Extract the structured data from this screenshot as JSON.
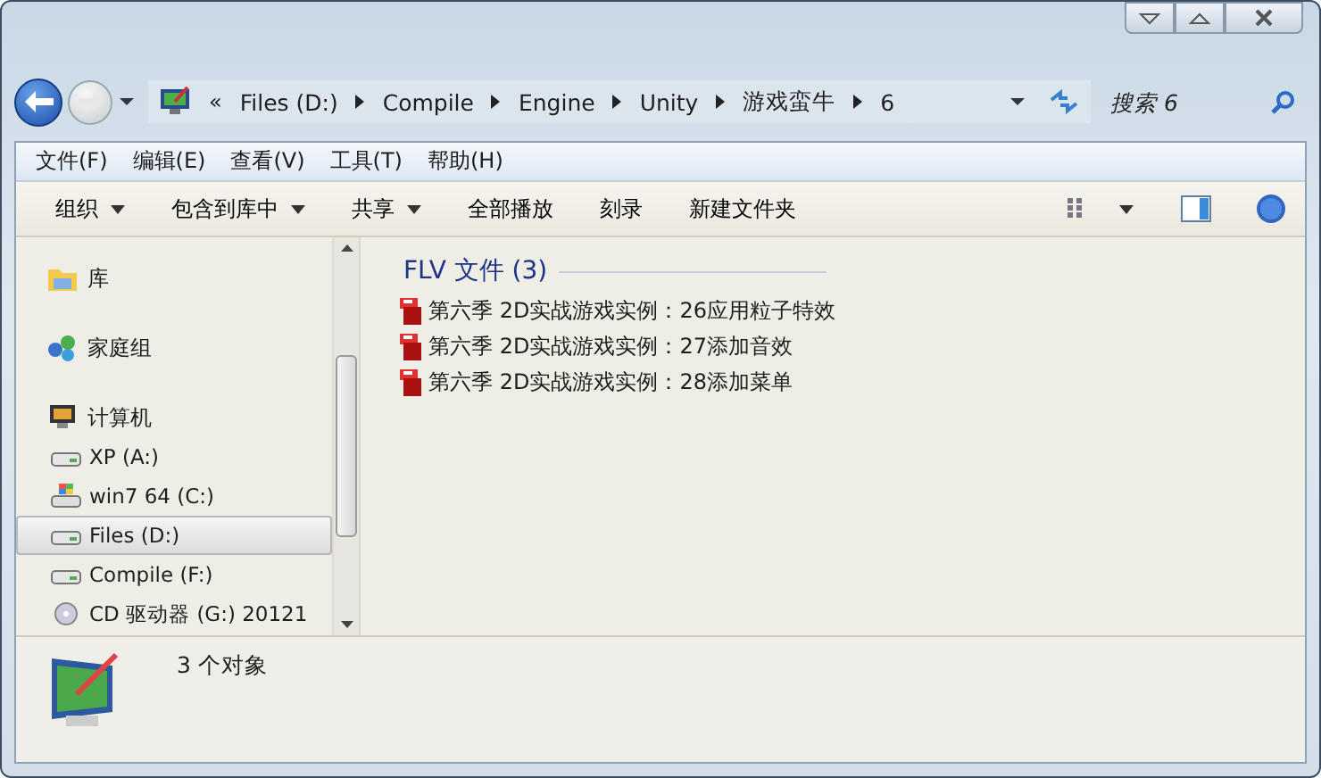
{
  "address_bar": {
    "overflow": "«",
    "crumbs": [
      "Files (D:)",
      "Compile",
      "Engine",
      "Unity",
      "游戏蛮牛",
      "6"
    ],
    "search": {
      "placeholder": "搜索 6"
    }
  },
  "menu_bar": [
    "文件(F)",
    "编辑(E)",
    "查看(V)",
    "工具(T)",
    "帮助(H)"
  ],
  "toolbar": [
    {
      "label": "组织",
      "dropdown": true
    },
    {
      "label": "包含到库中",
      "dropdown": true
    },
    {
      "label": "共享",
      "dropdown": true
    },
    {
      "label": "全部播放",
      "dropdown": false
    },
    {
      "label": "刻录",
      "dropdown": false
    },
    {
      "label": "新建文件夹",
      "dropdown": false
    }
  ],
  "sidebar": {
    "items": [
      {
        "kind": "library",
        "label": "库",
        "selected": false
      },
      {
        "kind": "homegroup",
        "label": "家庭组",
        "selected": false
      },
      {
        "kind": "computer",
        "label": "计算机",
        "selected": false,
        "children": [
          {
            "kind": "drive",
            "label": "XP (A:)",
            "selected": false
          },
          {
            "kind": "system",
            "label": "win7 64 (C:)",
            "selected": false
          },
          {
            "kind": "drive",
            "label": "Files (D:)",
            "selected": true
          },
          {
            "kind": "drive",
            "label": "Compile (F:)",
            "selected": false
          },
          {
            "kind": "cd",
            "label": "CD 驱动器 (G:) 20121",
            "selected": false
          }
        ]
      }
    ]
  },
  "content": {
    "group": "FLV 文件 (3)",
    "files": [
      "第六季 2D实战游戏实例：26应用粒子特效",
      "第六季 2D实战游戏实例：27添加音效",
      "第六季 2D实战游戏实例：28添加菜单"
    ]
  },
  "status_bar": {
    "text": "3 个对象"
  }
}
